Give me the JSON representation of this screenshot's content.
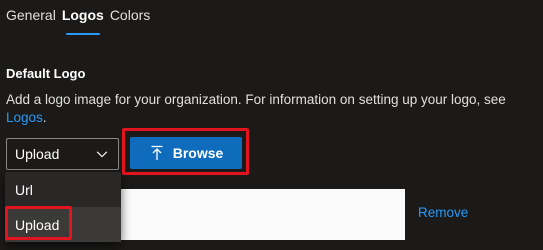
{
  "tabs": [
    {
      "label": "General",
      "active": false
    },
    {
      "label": "Logos",
      "active": true
    },
    {
      "label": "Colors",
      "active": false
    }
  ],
  "section": {
    "title": "Default Logo",
    "description": "Add a logo image for your organization. For information on setting up your logo, see ",
    "link_text": "Logos",
    "description_end": "."
  },
  "dropdown": {
    "value": "Upload",
    "options": [
      "Url",
      "Upload"
    ],
    "selected": "Upload"
  },
  "browse": {
    "label": "Browse",
    "icon": "upload-arrow-icon"
  },
  "remove_label": "Remove",
  "colors": {
    "accent": "#2899f5",
    "button": "#0f6cbd",
    "highlight": "#e3141e",
    "background": "#1b1a19"
  }
}
